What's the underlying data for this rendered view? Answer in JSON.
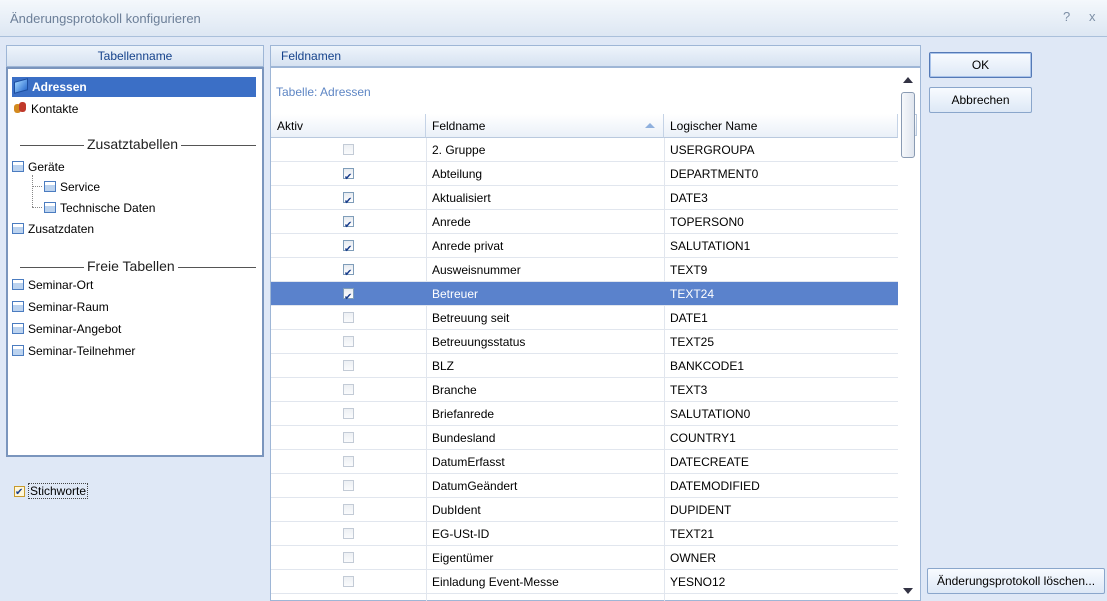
{
  "window": {
    "title": "Änderungsprotokoll konfigurieren",
    "help_glyph": "?",
    "close_glyph": "x"
  },
  "left": {
    "header": "Tabellenname",
    "items": [
      {
        "label": "Adressen",
        "icon": "book-icon"
      },
      {
        "label": "Kontakte",
        "icon": "contacts-icon"
      }
    ],
    "section_zusatz": "Zusatztabellen",
    "zusatz": {
      "geraete": "Geräte",
      "service": "Service",
      "technische": "Technische Daten",
      "zusatzdaten": "Zusatzdaten"
    },
    "section_frei": "Freie Tabellen",
    "frei": [
      "Seminar-Ort",
      "Seminar-Raum",
      "Seminar-Angebot",
      "Seminar-Teilnehmer"
    ],
    "stichworte": {
      "label": "Stichworte",
      "checked": true
    }
  },
  "middle": {
    "header": "Feldnamen",
    "table_caption": "Tabelle: Adressen",
    "columns": {
      "aktiv": "Aktiv",
      "feldname": "Feldname",
      "logisch": "Logischer Name"
    },
    "rows": [
      {
        "aktiv": false,
        "feldname": "2. Gruppe",
        "logisch": "USERGROUPA"
      },
      {
        "aktiv": true,
        "feldname": "Abteilung",
        "logisch": "DEPARTMENT0"
      },
      {
        "aktiv": true,
        "feldname": "Aktualisiert",
        "logisch": "DATE3"
      },
      {
        "aktiv": true,
        "feldname": "Anrede",
        "logisch": "TOPERSON0"
      },
      {
        "aktiv": true,
        "feldname": "Anrede privat",
        "logisch": "SALUTATION1"
      },
      {
        "aktiv": true,
        "feldname": "Ausweisnummer",
        "logisch": "TEXT9"
      },
      {
        "aktiv": true,
        "feldname": "Betreuer",
        "logisch": "TEXT24",
        "selected": true
      },
      {
        "aktiv": false,
        "feldname": "Betreuung seit",
        "logisch": "DATE1"
      },
      {
        "aktiv": false,
        "feldname": "Betreuungsstatus",
        "logisch": "TEXT25"
      },
      {
        "aktiv": false,
        "feldname": "BLZ",
        "logisch": "BANKCODE1"
      },
      {
        "aktiv": false,
        "feldname": "Branche",
        "logisch": "TEXT3"
      },
      {
        "aktiv": false,
        "feldname": "Briefanrede",
        "logisch": "SALUTATION0"
      },
      {
        "aktiv": false,
        "feldname": "Bundesland",
        "logisch": "COUNTRY1"
      },
      {
        "aktiv": false,
        "feldname": "DatumErfasst",
        "logisch": "DATECREATE"
      },
      {
        "aktiv": false,
        "feldname": "DatumGeändert",
        "logisch": "DATEMODIFIED"
      },
      {
        "aktiv": false,
        "feldname": "DubIdent",
        "logisch": "DUPIDENT"
      },
      {
        "aktiv": false,
        "feldname": "EG-USt-ID",
        "logisch": "TEXT21"
      },
      {
        "aktiv": false,
        "feldname": "Eigentümer",
        "logisch": "OWNER"
      },
      {
        "aktiv": false,
        "feldname": "Einladung Event-Messe",
        "logisch": "YESNO12"
      }
    ]
  },
  "buttons": {
    "ok": "OK",
    "cancel": "Abbrechen",
    "delete_log": "Änderungsprotokoll löschen..."
  },
  "colors": {
    "selection": "#3b6fc6",
    "row_selection": "#5a82cc",
    "header_text": "#15428b"
  }
}
